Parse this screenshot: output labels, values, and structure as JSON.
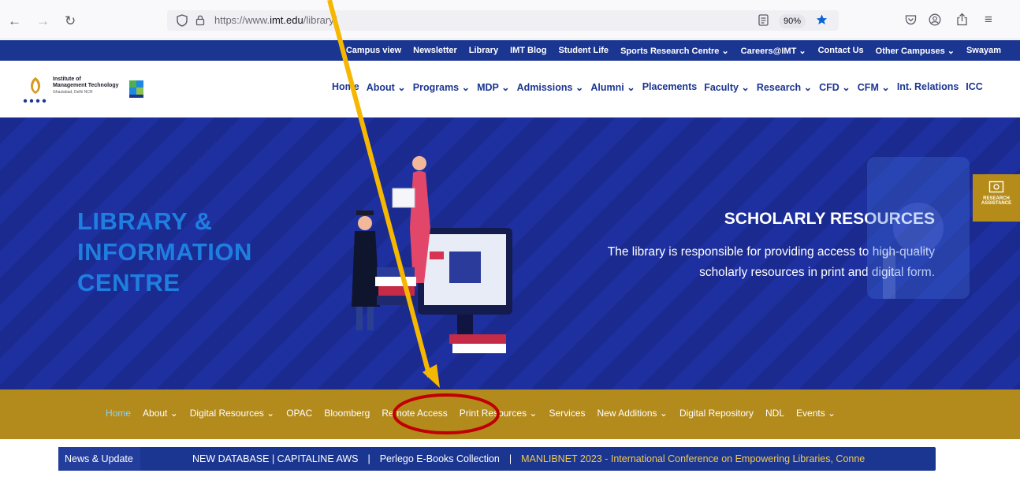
{
  "browser": {
    "url_prefix": "https://www.",
    "url_domain": "imt.edu",
    "url_path": "/library/",
    "zoom": "90%"
  },
  "topbar": {
    "links": [
      "Campus view",
      "Newsletter",
      "Library",
      "IMT Blog",
      "Student Life",
      "Sports Research Centre ⌄",
      "Careers@IMT ⌄",
      "Contact Us",
      "Other Campuses ⌄",
      "Swayam"
    ]
  },
  "header": {
    "logo_line1": "Institute of",
    "logo_line2": "Management Technology",
    "logo_line3": "Ghaziabad, Delhi NCR",
    "nav": [
      "Home",
      "About ⌄",
      "Programs ⌄",
      "MDP ⌄",
      "Admissions ⌄",
      "Alumni ⌄",
      "Placements",
      "Faculty ⌄",
      "Research ⌄",
      "CFD ⌄",
      "CFM ⌄",
      "Int. Relations",
      "ICC"
    ]
  },
  "hero": {
    "title_lines": [
      "LIBRARY &",
      "INFORMATION",
      "CENTRE"
    ],
    "heading": "SCHOLARLY RESOURCES",
    "desc_line1": "The library is responsible for providing access to high-quality",
    "desc_line2": "scholarly resources in print and digital form.",
    "badge_line1": "RESEARCH",
    "badge_line2": "ASSISTANCE"
  },
  "libnav": {
    "items": [
      "Home",
      "About ⌄",
      "Digital Resources ⌄",
      "OPAC",
      "Bloomberg",
      "Remote Access",
      "Print Resources ⌄",
      "Services",
      "New Additions ⌄",
      "Digital Repository",
      "NDL",
      "Events ⌄"
    ]
  },
  "news": {
    "label": "News & Update",
    "item1": "NEW DATABASE | CAPITALINE AWS",
    "item2": "Perlego E-Books Collection",
    "item3": "MANLIBNET 2023 - International Conference on Empowering Libraries, Conne"
  },
  "colors": {
    "brand_blue": "#1b3691",
    "gold": "#b38a1c",
    "annotation_arrow": "#f5b700",
    "annotation_circle": "#c00000"
  }
}
